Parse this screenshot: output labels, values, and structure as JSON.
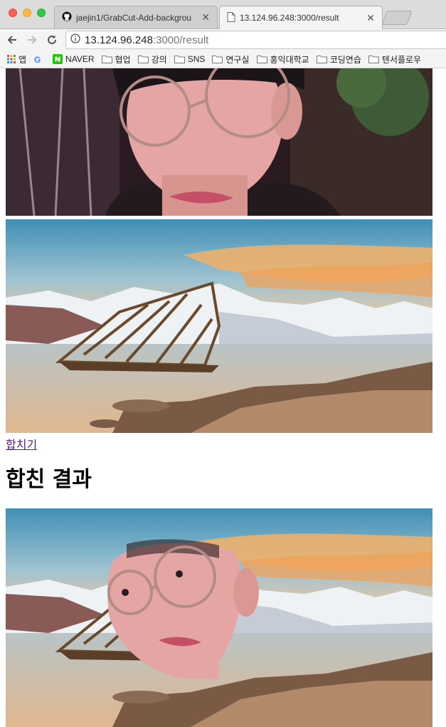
{
  "browser": {
    "tabs": [
      {
        "title": "jaejin1/GrabCut-Add-backgrou",
        "close": "✕",
        "icon": "github-icon",
        "active": false
      },
      {
        "title": "13.124.96.248:3000/result",
        "close": "✕",
        "icon": "page-icon",
        "active": true
      }
    ],
    "url_host": "13.124.96.248",
    "url_path": ":3000/result",
    "bookmarks": [
      {
        "label": "앱",
        "icon": "apps-grid-icon"
      },
      {
        "label": "",
        "icon": "google-icon"
      },
      {
        "label": "NAVER",
        "icon": "naver-icon"
      },
      {
        "label": "협업",
        "icon": "folder-icon"
      },
      {
        "label": "강의",
        "icon": "folder-icon"
      },
      {
        "label": "SNS",
        "icon": "folder-icon"
      },
      {
        "label": "연구실",
        "icon": "folder-icon"
      },
      {
        "label": "홍익대학교",
        "icon": "folder-icon"
      },
      {
        "label": "코딩연습",
        "icon": "folder-icon"
      },
      {
        "label": "텐서플로우",
        "icon": "folder-icon"
      }
    ]
  },
  "page": {
    "merge_link": "합치기",
    "result_heading": "합친 결과"
  },
  "colors": {
    "link": "#551a8b",
    "sky_top": "#3f8fb6",
    "sunset": "#f3b066"
  }
}
